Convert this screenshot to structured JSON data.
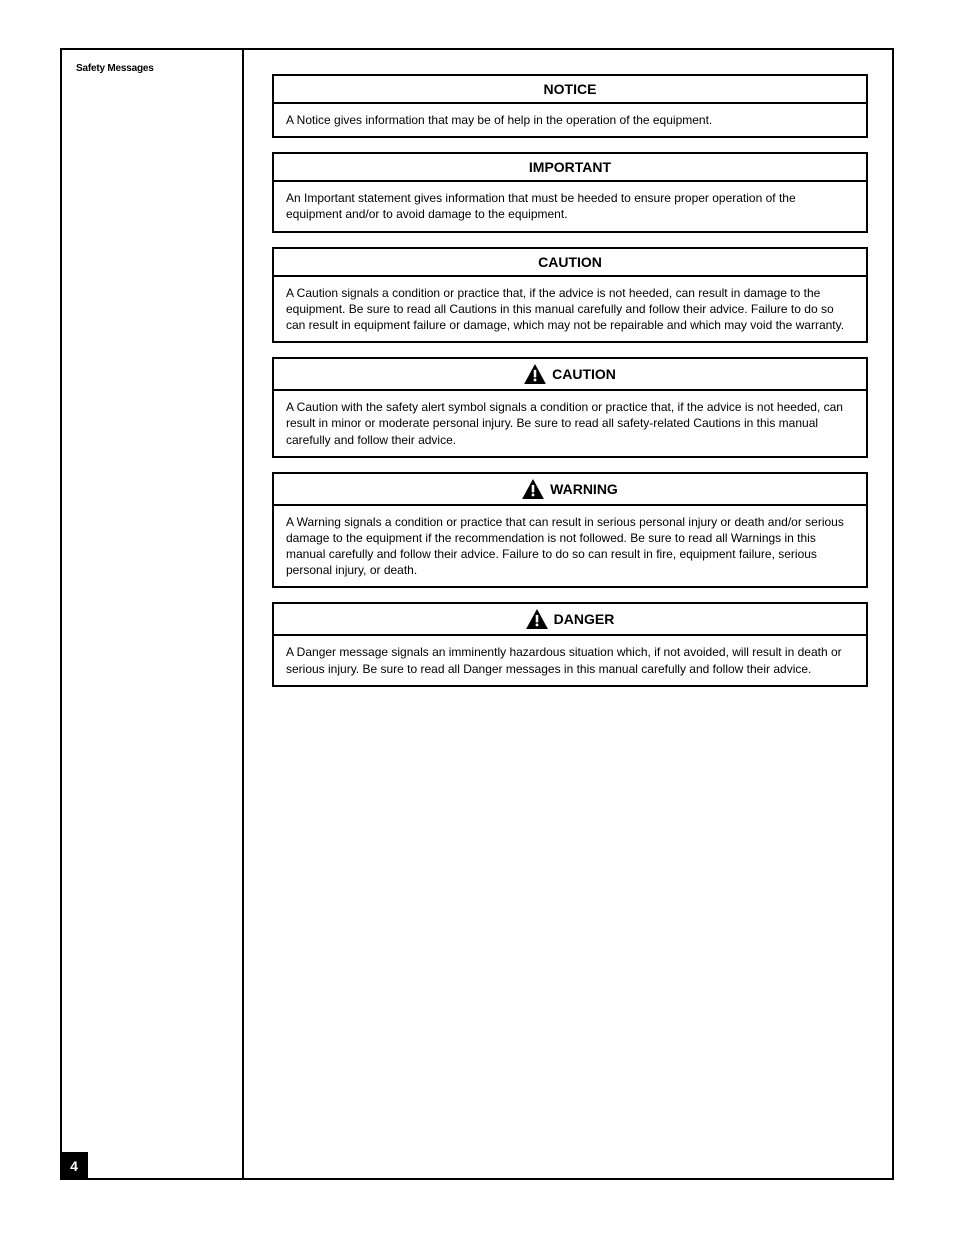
{
  "page_number": "4",
  "sidebar_heading": "Safety Messages",
  "callouts": [
    {
      "header": "NOTICE",
      "icon": false,
      "body": "A Notice gives information that may be of help in the operation of the equipment."
    },
    {
      "header": "IMPORTANT",
      "icon": false,
      "body": "An Important statement gives information that must be heeded to ensure proper operation of the equipment and/or to avoid damage to the equipment."
    },
    {
      "header": "CAUTION",
      "icon": false,
      "body": "A Caution signals a condition or practice that, if the advice is not heeded, can result in damage to the equipment. Be sure to read all Cautions in this manual carefully and follow their advice. Failure to do so can result in equipment failure or damage, which may not be repairable and which may void the warranty."
    },
    {
      "header": "CAUTION",
      "icon": true,
      "body": "A Caution with the safety alert symbol signals a condition or practice that, if the advice is not heeded, can result in minor or moderate personal injury. Be sure to read all safety-related Cautions in this manual carefully and follow their advice."
    },
    {
      "header": "WARNING",
      "icon": true,
      "body": "A Warning signals a condition or practice that can result in serious personal injury or death and/or serious damage to the equipment if the recommendation is not followed. Be sure to read all Warnings in this manual carefully and follow their advice. Failure to do so can result in fire, equipment failure, serious personal injury, or death."
    },
    {
      "header": "DANGER",
      "icon": true,
      "body": "A Danger message signals an imminently hazardous situation which, if not avoided, will result in death or serious injury. Be sure to read all Danger messages in this manual carefully and follow their advice."
    }
  ]
}
